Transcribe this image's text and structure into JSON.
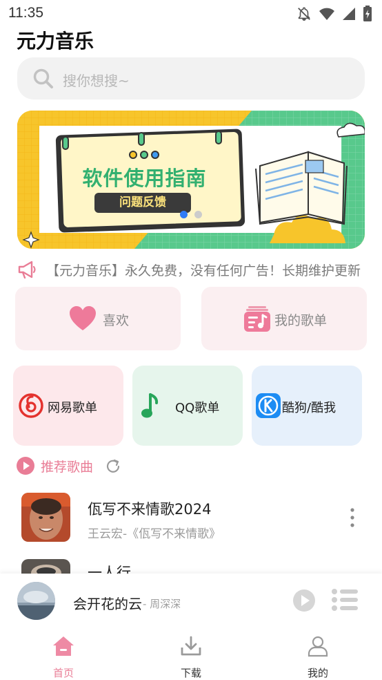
{
  "status_bar": {
    "time": "11:35",
    "icons": [
      "notifications-off-icon",
      "wifi-icon",
      "cell-signal-icon",
      "battery-charging-icon"
    ]
  },
  "app": {
    "title": "元力音乐"
  },
  "search": {
    "placeholder": "搜你想搜~",
    "icon": "search-icon"
  },
  "banner": {
    "title": "软件使用指南",
    "subtitle": "问题反馈",
    "slide_count": 2,
    "active_slide": 1,
    "colors": {
      "yellow": "#f7c52b",
      "green": "#58c98c",
      "title_green": "#32b070"
    }
  },
  "notice": {
    "icon": "megaphone-icon",
    "text": "【元力音乐】永久免费，没有任何广告！长期维护更新"
  },
  "quick_actions": [
    {
      "label": "喜欢",
      "icon": "heart-icon"
    },
    {
      "label": "我的歌单",
      "icon": "playlist-icon"
    }
  ],
  "platforms": [
    {
      "label": "网易歌单",
      "icon": "netease-music-icon",
      "color": "#e4322e"
    },
    {
      "label": "QQ歌单",
      "icon": "qq-music-note-icon",
      "color": "#27a55a"
    },
    {
      "label": "酷狗/酷我",
      "icon": "kugou-icon",
      "color": "#1d8cf3"
    }
  ],
  "recommend": {
    "title": "推荐歌曲",
    "accent": "#e97d96"
  },
  "songs": [
    {
      "title": "佤写不来情歌2024",
      "subtitle": "王云宏-《佤写不来情歌》"
    },
    {
      "title": "一人行",
      "subtitle": ""
    }
  ],
  "player": {
    "title": "会开花的云",
    "artist": "- 周深深"
  },
  "tabs": [
    {
      "label": "首页",
      "icon": "home-icon",
      "active": true
    },
    {
      "label": "下载",
      "icon": "download-icon",
      "active": false
    },
    {
      "label": "我的",
      "icon": "user-icon",
      "active": false
    }
  ]
}
